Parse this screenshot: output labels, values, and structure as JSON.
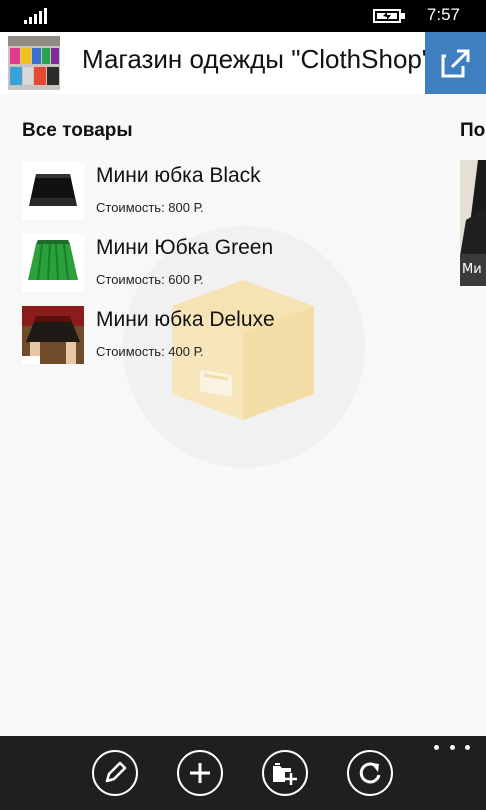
{
  "status_bar": {
    "time": "7:57"
  },
  "header": {
    "title": "Магазин одежды \"ClothShop\""
  },
  "sections": {
    "all_products_title": "Все товары",
    "peek_title": "По",
    "peek_item_label": "Ми"
  },
  "products": [
    {
      "name": "Мини юбка Black",
      "price": "Стоимость: 800 Р."
    },
    {
      "name": "Мини Юбка Green",
      "price": "Стоимость: 600 Р."
    },
    {
      "name": "Мини юбка Deluxe",
      "price": "Стоимость: 400 Р."
    }
  ],
  "app_bar": {
    "buttons": [
      "edit-icon",
      "add-icon",
      "add-folder-icon",
      "refresh-icon"
    ],
    "more": "more-icon"
  },
  "colors": {
    "accent": "#3d7fbf",
    "app_bar": "#1f1f1f",
    "background": "#f8f8f8"
  }
}
